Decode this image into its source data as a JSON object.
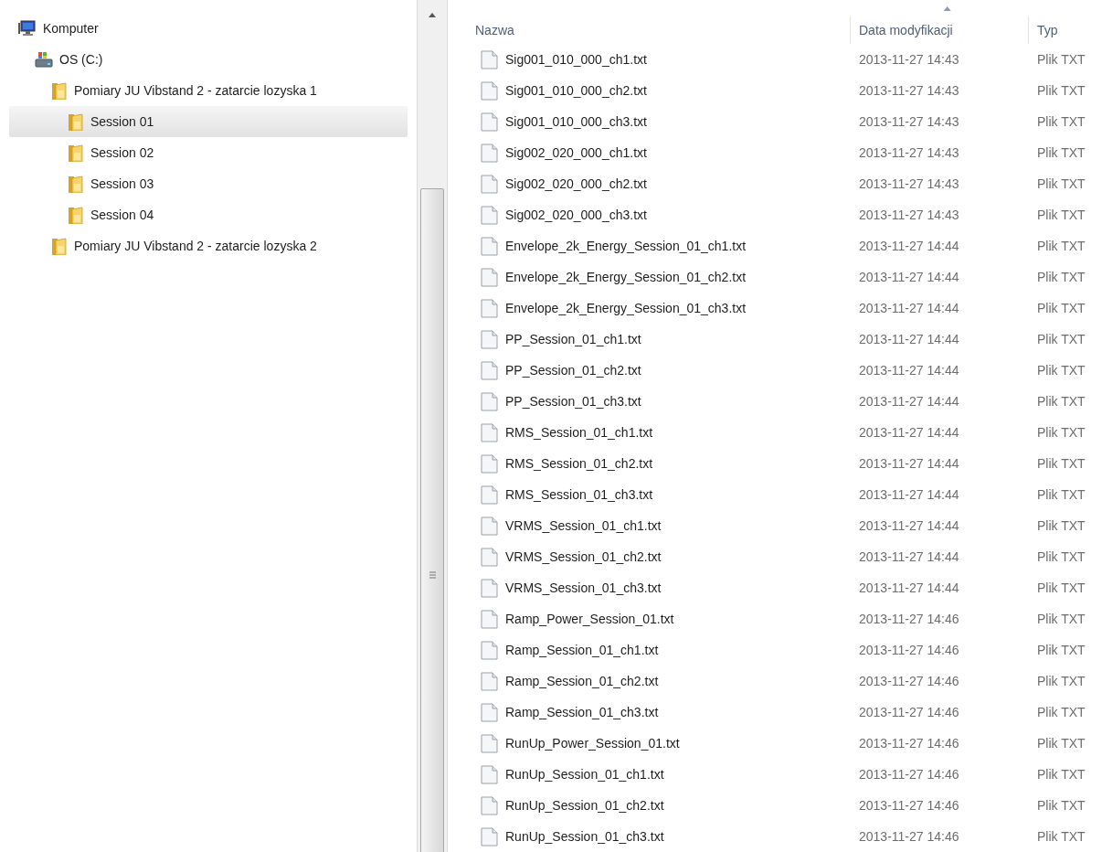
{
  "navigation_tree": [
    {
      "label": "Komputer",
      "kind": "computer",
      "selected": false,
      "children": [
        {
          "label": "OS (C:)",
          "kind": "drive",
          "selected": false,
          "children": [
            {
              "label": "Pomiary JU Vibstand 2 - zatarcie lozyska 1",
              "kind": "folder",
              "selected": false,
              "children": [
                {
                  "label": "Session 01",
                  "kind": "folder",
                  "selected": true
                },
                {
                  "label": "Session 02",
                  "kind": "folder",
                  "selected": false
                },
                {
                  "label": "Session 03",
                  "kind": "folder",
                  "selected": false
                },
                {
                  "label": "Session 04",
                  "kind": "folder",
                  "selected": false
                }
              ]
            },
            {
              "label": "Pomiary JU Vibstand 2 - zatarcie lozyska 2",
              "kind": "folder",
              "selected": false
            }
          ]
        }
      ]
    }
  ],
  "file_list": {
    "columns": [
      {
        "label": "Nazwa",
        "sorted": false
      },
      {
        "label": "Data modyfikacji",
        "sorted": true
      },
      {
        "label": "Typ",
        "sorted": false
      }
    ],
    "rows": [
      [
        "Sig001_010_000_ch1.txt",
        "2013-11-27 14:43",
        "Plik TXT"
      ],
      [
        "Sig001_010_000_ch2.txt",
        "2013-11-27 14:43",
        "Plik TXT"
      ],
      [
        "Sig001_010_000_ch3.txt",
        "2013-11-27 14:43",
        "Plik TXT"
      ],
      [
        "Sig002_020_000_ch1.txt",
        "2013-11-27 14:43",
        "Plik TXT"
      ],
      [
        "Sig002_020_000_ch2.txt",
        "2013-11-27 14:43",
        "Plik TXT"
      ],
      [
        "Sig002_020_000_ch3.txt",
        "2013-11-27 14:43",
        "Plik TXT"
      ],
      [
        "Envelope_2k_Energy_Session_01_ch1.txt",
        "2013-11-27 14:44",
        "Plik TXT"
      ],
      [
        "Envelope_2k_Energy_Session_01_ch2.txt",
        "2013-11-27 14:44",
        "Plik TXT"
      ],
      [
        "Envelope_2k_Energy_Session_01_ch3.txt",
        "2013-11-27 14:44",
        "Plik TXT"
      ],
      [
        "PP_Session_01_ch1.txt",
        "2013-11-27 14:44",
        "Plik TXT"
      ],
      [
        "PP_Session_01_ch2.txt",
        "2013-11-27 14:44",
        "Plik TXT"
      ],
      [
        "PP_Session_01_ch3.txt",
        "2013-11-27 14:44",
        "Plik TXT"
      ],
      [
        "RMS_Session_01_ch1.txt",
        "2013-11-27 14:44",
        "Plik TXT"
      ],
      [
        "RMS_Session_01_ch2.txt",
        "2013-11-27 14:44",
        "Plik TXT"
      ],
      [
        "RMS_Session_01_ch3.txt",
        "2013-11-27 14:44",
        "Plik TXT"
      ],
      [
        "VRMS_Session_01_ch1.txt",
        "2013-11-27 14:44",
        "Plik TXT"
      ],
      [
        "VRMS_Session_01_ch2.txt",
        "2013-11-27 14:44",
        "Plik TXT"
      ],
      [
        "VRMS_Session_01_ch3.txt",
        "2013-11-27 14:44",
        "Plik TXT"
      ],
      [
        "Ramp_Power_Session_01.txt",
        "2013-11-27 14:46",
        "Plik TXT"
      ],
      [
        "Ramp_Session_01_ch1.txt",
        "2013-11-27 14:46",
        "Plik TXT"
      ],
      [
        "Ramp_Session_01_ch2.txt",
        "2013-11-27 14:46",
        "Plik TXT"
      ],
      [
        "Ramp_Session_01_ch3.txt",
        "2013-11-27 14:46",
        "Plik TXT"
      ],
      [
        "RunUp_Power_Session_01.txt",
        "2013-11-27 14:46",
        "Plik TXT"
      ],
      [
        "RunUp_Session_01_ch1.txt",
        "2013-11-27 14:46",
        "Plik TXT"
      ],
      [
        "RunUp_Session_01_ch2.txt",
        "2013-11-27 14:46",
        "Plik TXT"
      ],
      [
        "RunUp_Session_01_ch3.txt",
        "2013-11-27 14:46",
        "Plik TXT"
      ]
    ]
  }
}
